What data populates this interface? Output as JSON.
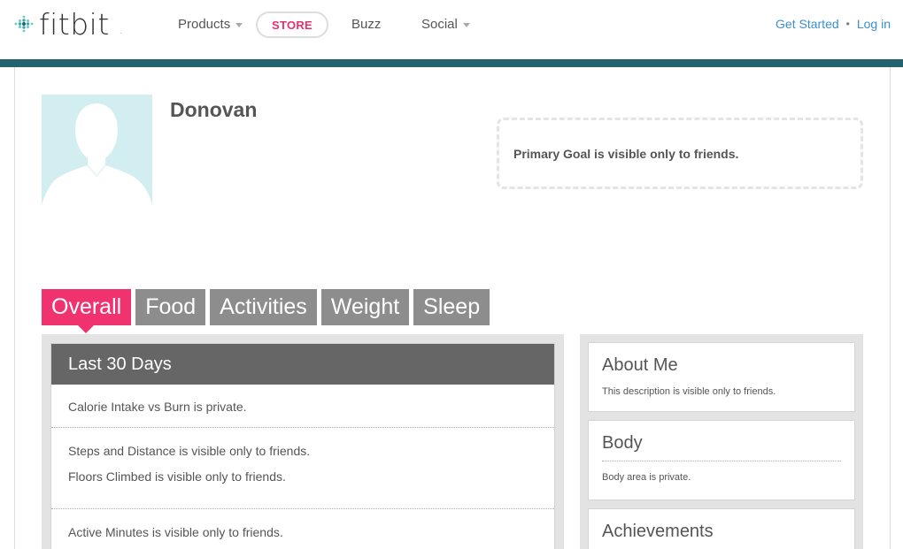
{
  "header": {
    "logo_text": "fitbit",
    "logo_trademark": ".",
    "nav": [
      {
        "label": "Products",
        "has_dropdown": true
      },
      {
        "label": "STORE"
      },
      {
        "label": "Buzz"
      },
      {
        "label": "Social",
        "has_dropdown": true
      }
    ],
    "auth": {
      "get_started": "Get Started",
      "separator": "•",
      "login": "Log in"
    }
  },
  "colors": {
    "brand_teal": "#24626f",
    "accent_pink": "#f0326e",
    "link_blue": "#3b8fd1",
    "tab_gray": "#8d8d8d"
  },
  "profile": {
    "name": "Donovan",
    "primary_goal": "Primary Goal is visible only to friends."
  },
  "tabs": [
    {
      "label": "Overall",
      "active": true
    },
    {
      "label": "Food"
    },
    {
      "label": "Activities"
    },
    {
      "label": "Weight"
    },
    {
      "label": "Sleep"
    }
  ],
  "overview": {
    "title": "Last 30 Days",
    "rows": [
      {
        "lines": [
          "Calorie Intake vs Burn is private."
        ]
      },
      {
        "lines": [
          "Steps and Distance is visible only to friends.",
          "Floors Climbed is visible only to friends."
        ]
      },
      {
        "lines": [
          "Active Minutes is visible only to friends."
        ]
      }
    ]
  },
  "sidebar": {
    "about": {
      "title": "About Me",
      "text": "This description is visible only to friends."
    },
    "body": {
      "title": "Body",
      "text": "Body area is private."
    },
    "achievements": {
      "title": "Achievements"
    }
  }
}
